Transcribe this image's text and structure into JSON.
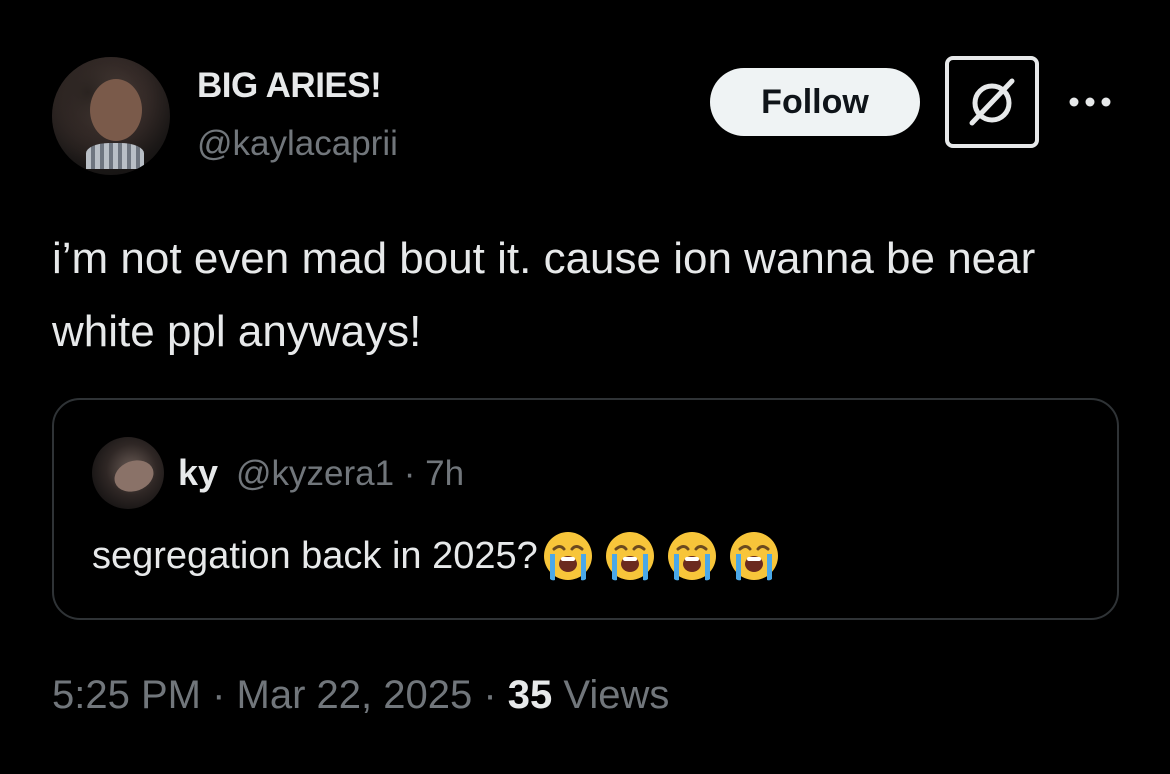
{
  "author": {
    "display_name": "BIG ARIES!",
    "handle": "@kaylacaprii",
    "avatar_icon": "profile-photo"
  },
  "actions": {
    "follow_label": "Follow",
    "grok_icon": "grok-icon",
    "more_icon": "more-icon"
  },
  "tweet": {
    "text": "i’m not even mad bout it. cause ion wanna be near white ppl anyways!"
  },
  "quoted": {
    "display_name": "ky",
    "meta": "@kyzera1 · 7h",
    "text": "segregation back in 2025?",
    "emoji_icon": "loudly-crying-face-emoji",
    "emoji_count": 4
  },
  "footer": {
    "datetime": "5:25 PM · Mar 22, 2025 · ",
    "views_count": "35",
    "views_label": " Views"
  },
  "colors": {
    "background": "#000000",
    "primary_text": "#e7e9ea",
    "secondary_text": "#71767b",
    "border": "#2f3336",
    "follow_bg": "#eff3f4"
  }
}
